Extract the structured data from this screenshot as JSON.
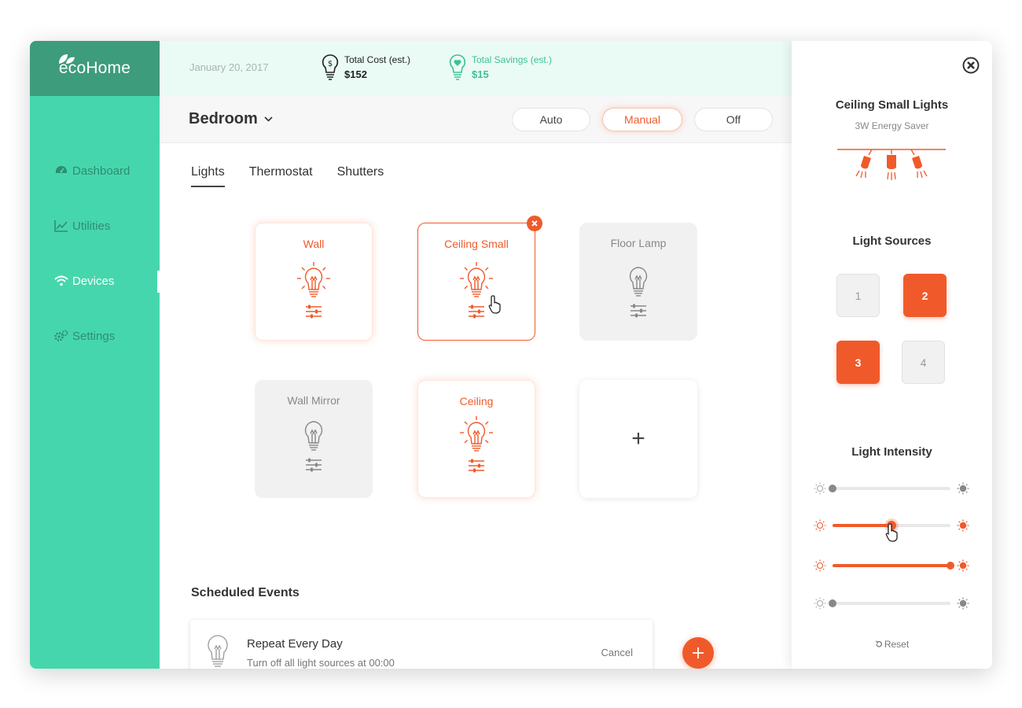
{
  "app": {
    "logo": "ecoHome"
  },
  "sidebar": {
    "items": [
      {
        "label": "Dashboard",
        "icon": "dashboard-icon"
      },
      {
        "label": "Utilities",
        "icon": "chart-icon"
      },
      {
        "label": "Devices",
        "icon": "wifi-icon",
        "active": true
      },
      {
        "label": "Settings",
        "icon": "gear-icon"
      }
    ]
  },
  "topbar": {
    "date": "January 20, 2017",
    "cost": {
      "label": "Total Cost (est.)",
      "value": "$152"
    },
    "savings": {
      "label": "Total Savings (est.)",
      "value": "$15"
    }
  },
  "room": {
    "name": "Bedroom",
    "modes": [
      "Auto",
      "Manual",
      "Off"
    ],
    "active_mode": "Manual"
  },
  "tabs": {
    "items": [
      "Lights",
      "Thermostat",
      "Shutters"
    ],
    "active": "Lights"
  },
  "devices": [
    {
      "name": "Wall",
      "state": "on"
    },
    {
      "name": "Ceiling Small",
      "state": "selected"
    },
    {
      "name": "Floor Lamp",
      "state": "off"
    },
    {
      "name": "Wall Mirror",
      "state": "off"
    },
    {
      "name": "Ceiling",
      "state": "on"
    }
  ],
  "add_device": {
    "symbol": "+"
  },
  "scheduled": {
    "title": "Scheduled Events",
    "event": {
      "title": "Repeat Every Day",
      "subtitle": "Turn off all light sources at 00:00",
      "cancel": "Cancel"
    }
  },
  "panel": {
    "title": "Ceiling Small Lights",
    "subtitle": "3W Energy Saver",
    "sources_title": "Light Sources",
    "sources": [
      {
        "label": "1",
        "on": false
      },
      {
        "label": "2",
        "on": true
      },
      {
        "label": "3",
        "on": true
      },
      {
        "label": "4",
        "on": false
      }
    ],
    "intensity_title": "Light Intensity",
    "intensity": [
      0,
      0.5,
      1.0,
      0
    ],
    "reset": "Reset"
  },
  "colors": {
    "accent": "#f05a2a",
    "sidebar": "#46d6ad",
    "logo_bg": "#3d9c7c",
    "savings": "#3fc198"
  }
}
